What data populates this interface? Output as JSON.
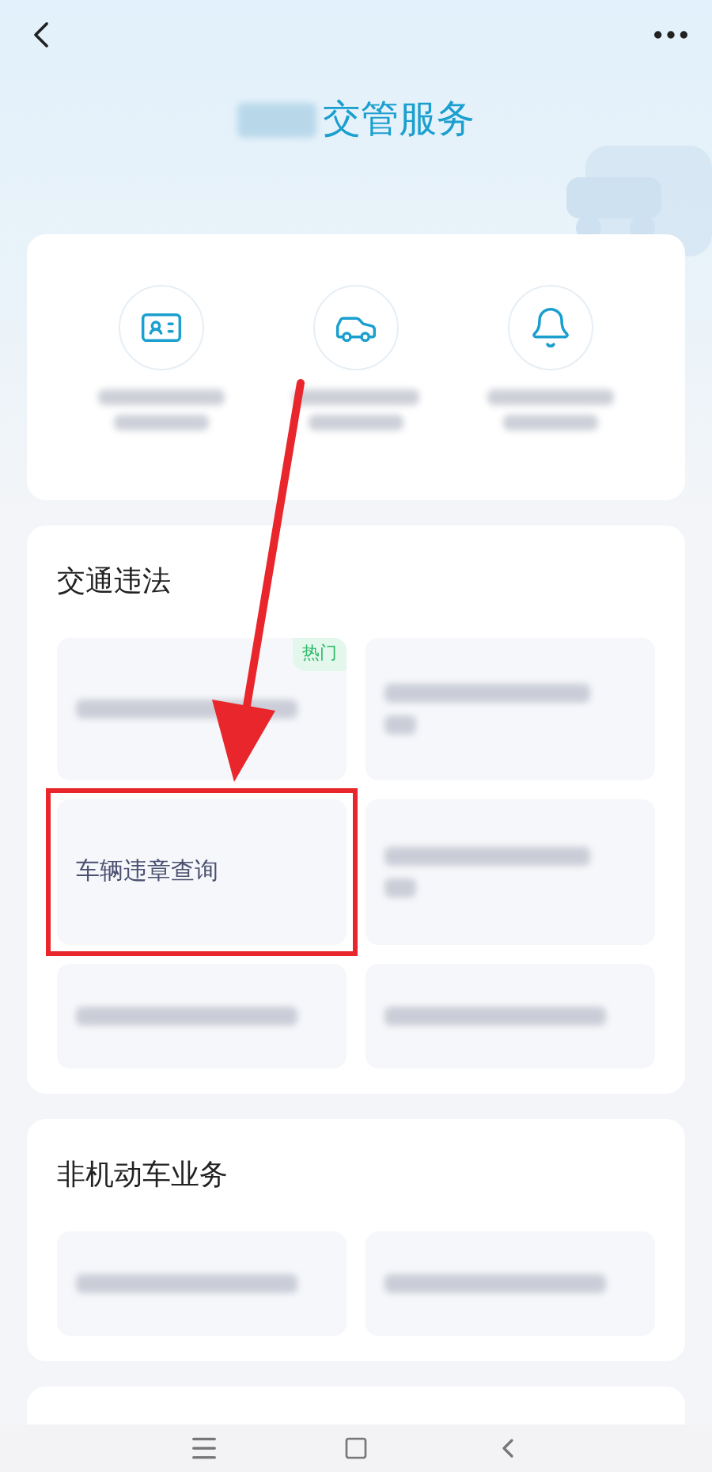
{
  "header": {
    "title": "交管服务"
  },
  "quick_services": [
    {
      "kind": "id-card"
    },
    {
      "kind": "car"
    },
    {
      "kind": "bell"
    }
  ],
  "sections": [
    {
      "title": "交通违法",
      "tiles": [
        {
          "kind": "blurred-short",
          "badge": "热门"
        },
        {
          "kind": "blurred-long"
        },
        {
          "kind": "text",
          "label": "车辆违章查询",
          "highlighted": true
        },
        {
          "kind": "blurred-long"
        },
        {
          "kind": "blurred-short"
        },
        {
          "kind": "blurred-short"
        }
      ]
    },
    {
      "title": "非机动车业务",
      "tiles": [
        {
          "kind": "blurred-short"
        },
        {
          "kind": "blurred-short"
        }
      ]
    }
  ]
}
